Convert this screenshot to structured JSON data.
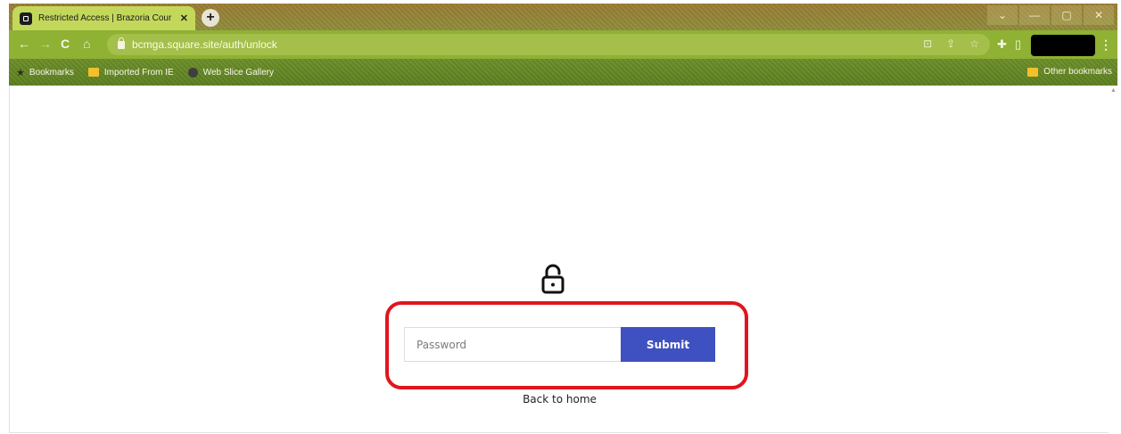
{
  "tab": {
    "title": "Restricted Access | Brazoria Cour",
    "close_glyph": "✕"
  },
  "new_tab_glyph": "+",
  "window_controls": [
    "⌄",
    "—",
    "▢",
    "✕"
  ],
  "nav": {
    "back": "←",
    "forward": "→",
    "reload": "C",
    "home": "⌂"
  },
  "omnibox": {
    "url": "bcmga.square.site/auth/unlock"
  },
  "toolbar_icons": {
    "install": "⊡",
    "share": "⇪",
    "bookmark_star": "☆",
    "extensions": "✚",
    "sidepanel": "▯",
    "menu": "⋮"
  },
  "bookmarks": {
    "items": [
      {
        "label": "Bookmarks",
        "icon": "star-icon"
      },
      {
        "label": "Imported From IE",
        "icon": "folder-icon"
      },
      {
        "label": "Web Slice Gallery",
        "icon": "globe-icon"
      }
    ],
    "other": "Other bookmarks"
  },
  "unlock_form": {
    "password_placeholder": "Password",
    "password_value": "",
    "submit_label": "Submit",
    "back_link": "Back to home",
    "highlight_color": "#e0161d",
    "submit_color": "#3f51c0"
  },
  "colors": {
    "toolbar": "#8fb134",
    "tab": "#c3d85a"
  }
}
